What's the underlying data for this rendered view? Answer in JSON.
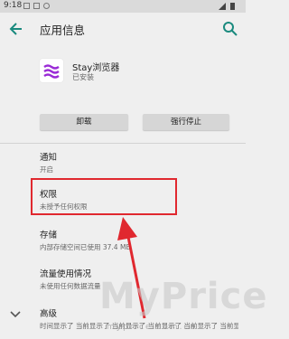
{
  "status_bar": {
    "time": "9:18"
  },
  "app_bar": {
    "title": "应用信息"
  },
  "app": {
    "name": "Stay浏览器",
    "status": "已安装"
  },
  "buttons": {
    "uninstall": "卸载",
    "force_stop": "强行停止"
  },
  "items": {
    "notifications": {
      "title": "通知",
      "subtitle": "开启"
    },
    "permissions": {
      "title": "权限",
      "subtitle": "未授予任何权限"
    },
    "storage": {
      "title": "存储",
      "subtitle": "内部存储空间已使用 37.4 MB"
    },
    "data_usage": {
      "title": "流量使用情况",
      "subtitle": "未使用任何数据流量"
    },
    "advanced": {
      "title": "高级",
      "subtitle": "时间显示了 当前显示了 当前显示了 当前显示了 当前显示了 当前显示了"
    }
  },
  "watermark": {
    "text": "MyPrice",
    "url": "myprice.com.cn"
  },
  "colors": {
    "accent": "#1a8a7e",
    "highlight": "#e0282f",
    "app_icon": "#9a2bd6"
  }
}
